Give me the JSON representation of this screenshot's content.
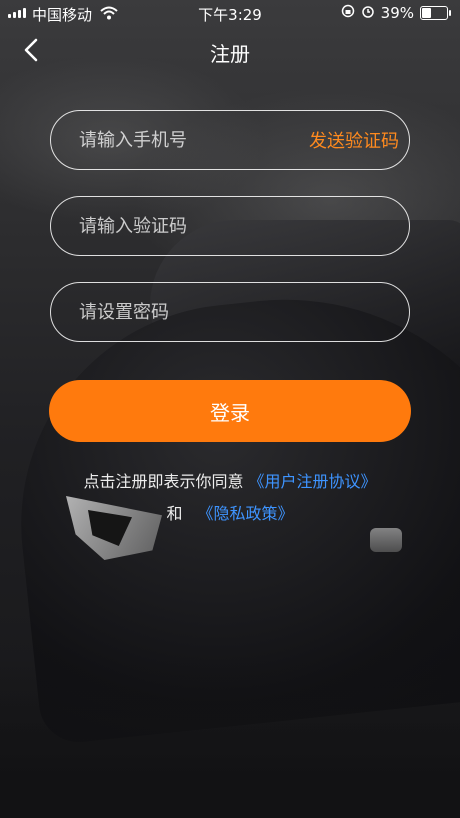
{
  "status_bar": {
    "carrier": "中国移动",
    "time": "下午3:29",
    "battery_percent": "39%",
    "battery_level": 0.39
  },
  "nav": {
    "title": "注册",
    "back_icon": "chevron-left-icon"
  },
  "form": {
    "phone_placeholder": "请输入手机号",
    "send_code_label": "发送验证码",
    "code_placeholder": "请输入验证码",
    "password_placeholder": "请设置密码",
    "submit_label": "登录"
  },
  "agreement": {
    "prefix": "点击注册即表示你同意",
    "terms_link": "《用户注册协议》",
    "conjunction": "和",
    "privacy_link": "《隐私政策》"
  },
  "colors": {
    "accent": "#ff7a0d",
    "link": "#3e94ff",
    "send_code": "#ff8a1e"
  }
}
